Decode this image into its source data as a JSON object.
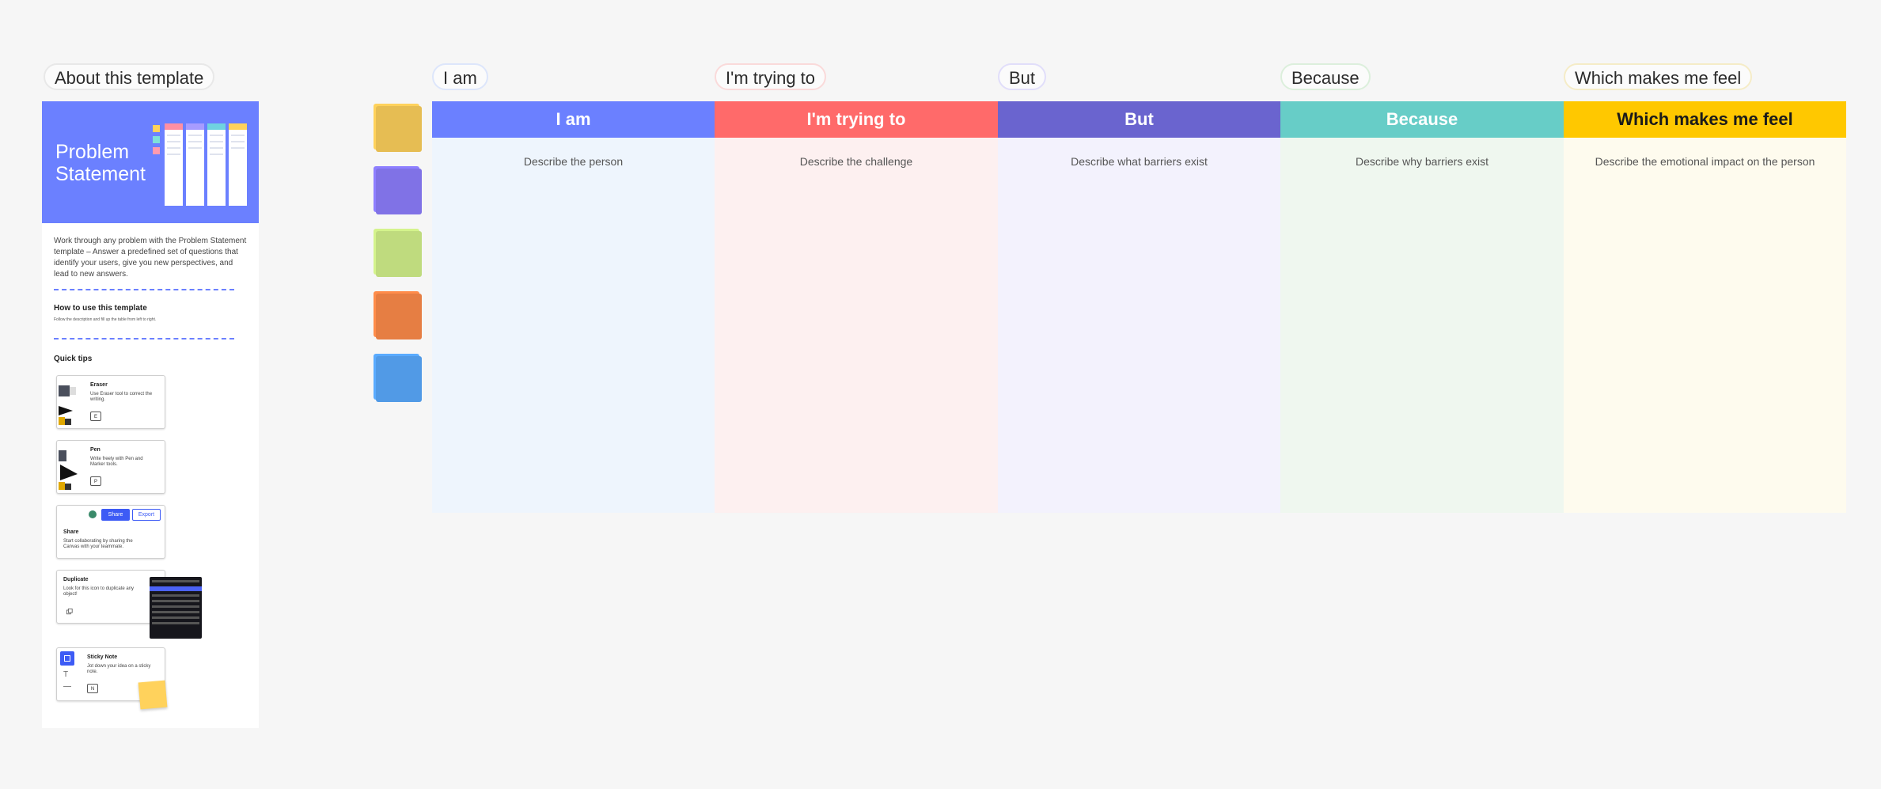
{
  "template_panel": {
    "label": "About this template",
    "hero_title_line1": "Problem",
    "hero_title_line2": "Statement",
    "description": "Work through any problem with the Problem Statement template – Answer a predefined set of questions that identify your users, give you new perspectives, and lead to new answers.",
    "how_to_title": "How to use this template",
    "how_to_text": "Follow the description and fill up the table from left to right.",
    "quick_tips_title": "Quick tips",
    "tips": [
      {
        "title": "Eraser",
        "text": "Use Eraser tool to correct the writing.",
        "key": "E"
      },
      {
        "title": "Pen",
        "text": "Write freely with Pen and Marker tools.",
        "key": "P"
      },
      {
        "title": "Share",
        "text": "Start collaborating by sharing the Canvas with your teammate.",
        "share_label": "Share",
        "export_label": "Export"
      },
      {
        "title": "Duplicate",
        "text": "Look for this icon to duplicate any object!"
      },
      {
        "title": "Sticky Note",
        "text": "Jot down your idea on a sticky note.",
        "key": "N"
      }
    ]
  },
  "stickies": [
    "#ffd25c",
    "#8e7fff",
    "#d4f38c",
    "#ff8c4a",
    "#5aabff"
  ],
  "columns": [
    {
      "tag": "I am",
      "header": "I am",
      "description": "Describe the person",
      "head_color": "#6b80ff",
      "body_color": "#eef5fd",
      "tag_border": "#dde6fb"
    },
    {
      "tag": "I'm trying to",
      "header": "I'm trying to",
      "description": "Describe the challenge",
      "head_color": "#ff6a6a",
      "body_color": "#fdf0f0",
      "tag_border": "#fadada"
    },
    {
      "tag": "But",
      "header": "But",
      "description": "Describe what barriers exist",
      "head_color": "#6a64cf",
      "body_color": "#f3f2fd",
      "tag_border": "#e1defa"
    },
    {
      "tag": "Because",
      "header": "Because",
      "description": "Describe why barriers exist",
      "head_color": "#67cdc7",
      "body_color": "#eff7ef",
      "tag_border": "#dcefdc"
    },
    {
      "tag": "Which makes me feel",
      "header": "Which makes me feel",
      "description": "Describe the emotional impact on the person",
      "head_color": "#ffc800",
      "body_color": "#fefbee",
      "tag_border": "#f5ecc7"
    }
  ]
}
